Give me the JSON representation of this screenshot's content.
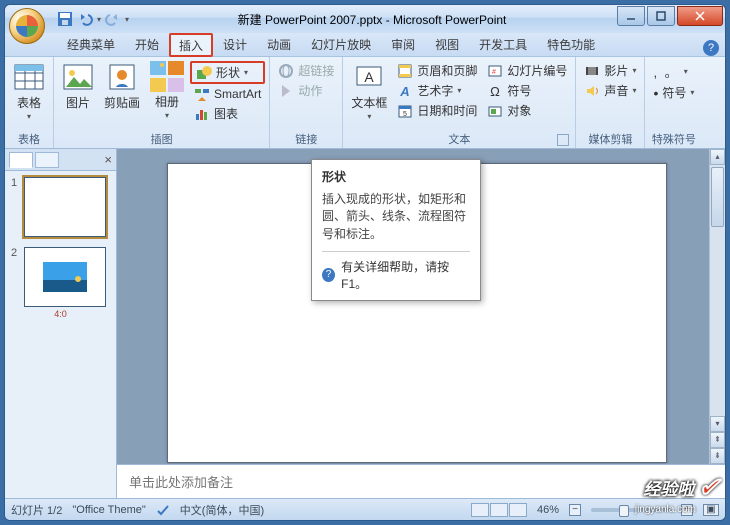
{
  "titlebar": {
    "title": "新建 PowerPoint 2007.pptx - Microsoft PowerPoint"
  },
  "tabs": {
    "items": [
      {
        "label": "经典菜单"
      },
      {
        "label": "开始"
      },
      {
        "label": "插入"
      },
      {
        "label": "设计"
      },
      {
        "label": "动画"
      },
      {
        "label": "幻灯片放映"
      },
      {
        "label": "审阅"
      },
      {
        "label": "视图"
      },
      {
        "label": "开发工具"
      },
      {
        "label": "特色功能"
      }
    ]
  },
  "ribbon": {
    "group_table": {
      "label": "表格",
      "button": "表格"
    },
    "group_illus": {
      "label": "插图",
      "picture": "图片",
      "clipart": "剪贴画",
      "album": "相册",
      "shapes": "形状",
      "smartart": "SmartArt",
      "chart": "图表"
    },
    "group_link": {
      "label": "链接",
      "hyperlink": "超链接",
      "action": "动作"
    },
    "group_text": {
      "label": "文本",
      "textbox": "文本框",
      "header_footer": "页眉和页脚",
      "wordart": "艺术字",
      "datetime": "日期和时间",
      "slide_num": "幻灯片编号",
      "symbol": "符号",
      "object": "对象"
    },
    "group_media": {
      "label": "媒体剪辑",
      "movie": "影片",
      "sound": "声音"
    },
    "group_special": {
      "label": "特殊符号",
      "symbol_btn": "符号"
    }
  },
  "tooltip": {
    "title": "形状",
    "body": "插入现成的形状，如矩形和圆、箭头、线条、流程图符号和标注。",
    "help": "有关详细帮助，请按 F1。"
  },
  "pane": {
    "slide1_num": "1",
    "slide2_num": "2",
    "slide2_cap": "4:0"
  },
  "notes": {
    "placeholder": "单击此处添加备注"
  },
  "status": {
    "slide_info": "幻灯片 1/2",
    "theme": "\"Office Theme\"",
    "lang": "中文(简体，中国)",
    "zoom": "46%"
  },
  "watermark": {
    "main": "经验啦",
    "sub": "jingyanla.com"
  }
}
